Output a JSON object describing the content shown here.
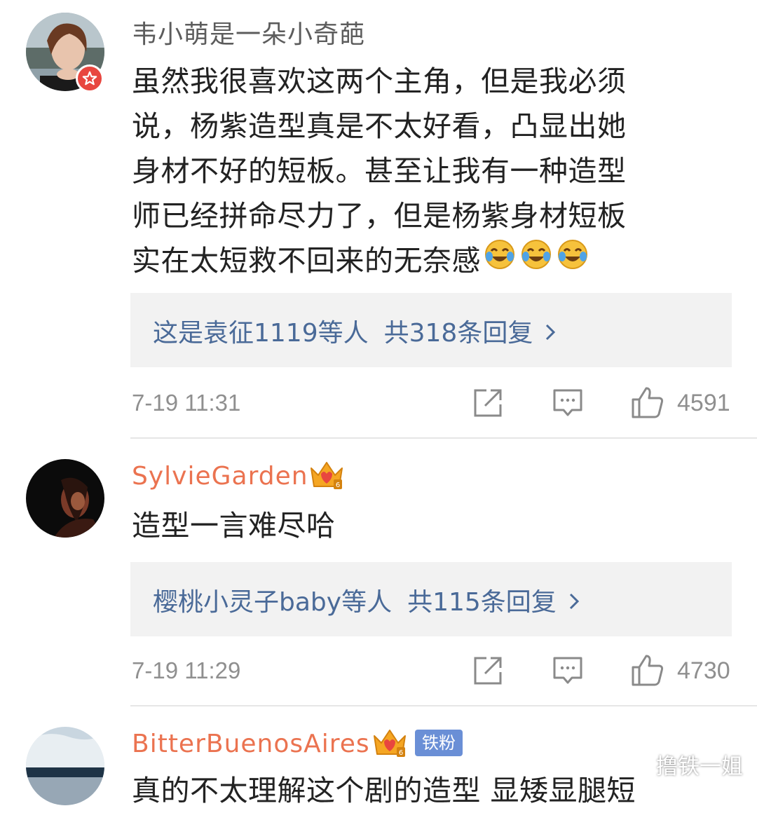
{
  "comments": [
    {
      "username": "韦小萌是一朵小奇葩",
      "lines": [
        "虽然我很喜欢这两个主角，但是我必须",
        "说，杨紫造型真是不太好看，凸显出她",
        "身材不好的短板。甚至让我有一种造型",
        "师已经拼命尽力了，但是杨紫身材短板",
        "实在太短救不回来的无奈感"
      ],
      "emoji": [
        "laughing-crying-emoji",
        "laughing-crying-emoji",
        "laughing-crying-emoji"
      ],
      "reply_names": "这是袁征1119等人",
      "reply_count": "共318条回复",
      "time": "7-19 11:31",
      "likes": "4591"
    },
    {
      "username": "SylvieGarden",
      "text": "造型一言难尽哈",
      "reply_names": "樱桃小灵子baby等人",
      "reply_count": "共115条回复",
      "time": "7-19 11:29",
      "likes": "4730"
    },
    {
      "username": "BitterBuenosAires",
      "badge": "铁粉",
      "text": "真的不太理解这个剧的造型 显矮显腿短"
    }
  ],
  "watermark": "撸铁一姐",
  "icons": {
    "verified": "verified-star-icon",
    "crown": "vip-crown-icon",
    "share": "share-icon",
    "comment": "comment-icon",
    "like": "like-icon",
    "chevron": "chevron-right-icon"
  },
  "colors": {
    "vip_name": "#eb7350",
    "link": "#4a6a98",
    "verified": "#e8463f",
    "fan_badge": "#6a8fd6"
  }
}
